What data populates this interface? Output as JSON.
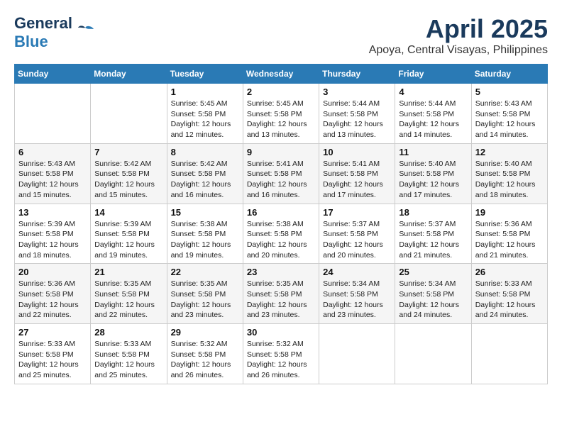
{
  "header": {
    "logo_line1": "General",
    "logo_line2": "Blue",
    "month_title": "April 2025",
    "location": "Apoya, Central Visayas, Philippines"
  },
  "weekdays": [
    "Sunday",
    "Monday",
    "Tuesday",
    "Wednesday",
    "Thursday",
    "Friday",
    "Saturday"
  ],
  "weeks": [
    [
      {
        "day": "",
        "info": ""
      },
      {
        "day": "",
        "info": ""
      },
      {
        "day": "1",
        "info": "Sunrise: 5:45 AM\nSunset: 5:58 PM\nDaylight: 12 hours\nand 12 minutes."
      },
      {
        "day": "2",
        "info": "Sunrise: 5:45 AM\nSunset: 5:58 PM\nDaylight: 12 hours\nand 13 minutes."
      },
      {
        "day": "3",
        "info": "Sunrise: 5:44 AM\nSunset: 5:58 PM\nDaylight: 12 hours\nand 13 minutes."
      },
      {
        "day": "4",
        "info": "Sunrise: 5:44 AM\nSunset: 5:58 PM\nDaylight: 12 hours\nand 14 minutes."
      },
      {
        "day": "5",
        "info": "Sunrise: 5:43 AM\nSunset: 5:58 PM\nDaylight: 12 hours\nand 14 minutes."
      }
    ],
    [
      {
        "day": "6",
        "info": "Sunrise: 5:43 AM\nSunset: 5:58 PM\nDaylight: 12 hours\nand 15 minutes."
      },
      {
        "day": "7",
        "info": "Sunrise: 5:42 AM\nSunset: 5:58 PM\nDaylight: 12 hours\nand 15 minutes."
      },
      {
        "day": "8",
        "info": "Sunrise: 5:42 AM\nSunset: 5:58 PM\nDaylight: 12 hours\nand 16 minutes."
      },
      {
        "day": "9",
        "info": "Sunrise: 5:41 AM\nSunset: 5:58 PM\nDaylight: 12 hours\nand 16 minutes."
      },
      {
        "day": "10",
        "info": "Sunrise: 5:41 AM\nSunset: 5:58 PM\nDaylight: 12 hours\nand 17 minutes."
      },
      {
        "day": "11",
        "info": "Sunrise: 5:40 AM\nSunset: 5:58 PM\nDaylight: 12 hours\nand 17 minutes."
      },
      {
        "day": "12",
        "info": "Sunrise: 5:40 AM\nSunset: 5:58 PM\nDaylight: 12 hours\nand 18 minutes."
      }
    ],
    [
      {
        "day": "13",
        "info": "Sunrise: 5:39 AM\nSunset: 5:58 PM\nDaylight: 12 hours\nand 18 minutes."
      },
      {
        "day": "14",
        "info": "Sunrise: 5:39 AM\nSunset: 5:58 PM\nDaylight: 12 hours\nand 19 minutes."
      },
      {
        "day": "15",
        "info": "Sunrise: 5:38 AM\nSunset: 5:58 PM\nDaylight: 12 hours\nand 19 minutes."
      },
      {
        "day": "16",
        "info": "Sunrise: 5:38 AM\nSunset: 5:58 PM\nDaylight: 12 hours\nand 20 minutes."
      },
      {
        "day": "17",
        "info": "Sunrise: 5:37 AM\nSunset: 5:58 PM\nDaylight: 12 hours\nand 20 minutes."
      },
      {
        "day": "18",
        "info": "Sunrise: 5:37 AM\nSunset: 5:58 PM\nDaylight: 12 hours\nand 21 minutes."
      },
      {
        "day": "19",
        "info": "Sunrise: 5:36 AM\nSunset: 5:58 PM\nDaylight: 12 hours\nand 21 minutes."
      }
    ],
    [
      {
        "day": "20",
        "info": "Sunrise: 5:36 AM\nSunset: 5:58 PM\nDaylight: 12 hours\nand 22 minutes."
      },
      {
        "day": "21",
        "info": "Sunrise: 5:35 AM\nSunset: 5:58 PM\nDaylight: 12 hours\nand 22 minutes."
      },
      {
        "day": "22",
        "info": "Sunrise: 5:35 AM\nSunset: 5:58 PM\nDaylight: 12 hours\nand 23 minutes."
      },
      {
        "day": "23",
        "info": "Sunrise: 5:35 AM\nSunset: 5:58 PM\nDaylight: 12 hours\nand 23 minutes."
      },
      {
        "day": "24",
        "info": "Sunrise: 5:34 AM\nSunset: 5:58 PM\nDaylight: 12 hours\nand 23 minutes."
      },
      {
        "day": "25",
        "info": "Sunrise: 5:34 AM\nSunset: 5:58 PM\nDaylight: 12 hours\nand 24 minutes."
      },
      {
        "day": "26",
        "info": "Sunrise: 5:33 AM\nSunset: 5:58 PM\nDaylight: 12 hours\nand 24 minutes."
      }
    ],
    [
      {
        "day": "27",
        "info": "Sunrise: 5:33 AM\nSunset: 5:58 PM\nDaylight: 12 hours\nand 25 minutes."
      },
      {
        "day": "28",
        "info": "Sunrise: 5:33 AM\nSunset: 5:58 PM\nDaylight: 12 hours\nand 25 minutes."
      },
      {
        "day": "29",
        "info": "Sunrise: 5:32 AM\nSunset: 5:58 PM\nDaylight: 12 hours\nand 26 minutes."
      },
      {
        "day": "30",
        "info": "Sunrise: 5:32 AM\nSunset: 5:58 PM\nDaylight: 12 hours\nand 26 minutes."
      },
      {
        "day": "",
        "info": ""
      },
      {
        "day": "",
        "info": ""
      },
      {
        "day": "",
        "info": ""
      }
    ]
  ]
}
